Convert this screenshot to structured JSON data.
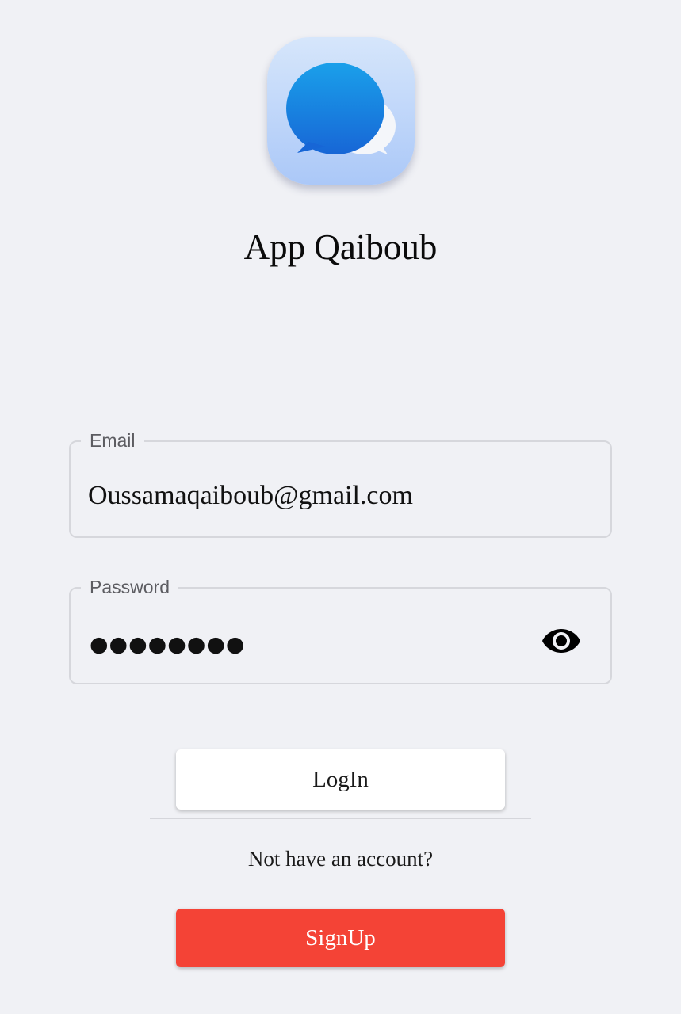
{
  "app": {
    "title": "App Qaiboub",
    "icon": "chat-bubbles-icon"
  },
  "login_form": {
    "email": {
      "label": "Email",
      "value": "Oussamaqaiboub@gmail.com"
    },
    "password": {
      "label": "Password",
      "masked_value": "●●●●●●●●",
      "toggle_icon": "eye-icon"
    },
    "login_button": "LogIn",
    "signup_prompt": "Not have an account?",
    "signup_button": "SignUp"
  },
  "colors": {
    "background": "#f0f1f5",
    "signup_button": "#f44336",
    "login_button": "#ffffff",
    "field_border": "#d6d7dc",
    "icon_bubble_front": "#1e7ae0",
    "icon_tile": "#b8d1f8"
  }
}
